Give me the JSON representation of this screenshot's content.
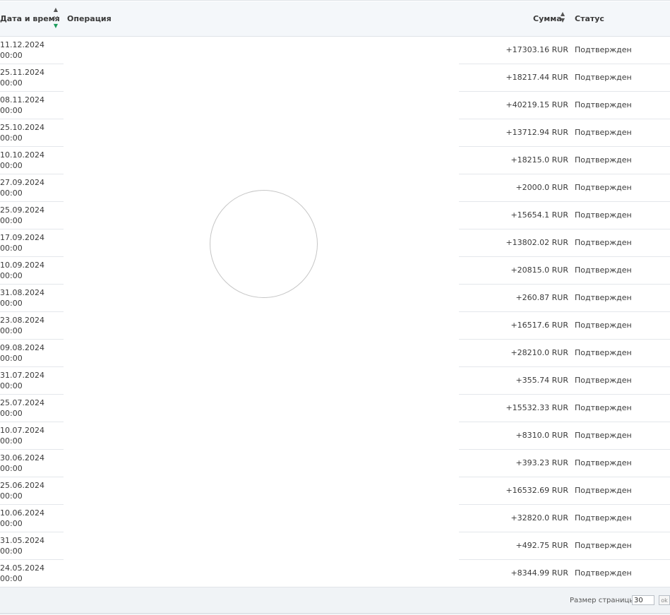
{
  "table": {
    "columns": {
      "date": "Дата и время",
      "operation": "Операция",
      "sum": "Сумма",
      "status": "Статус"
    },
    "sort": {
      "date_clear": "×",
      "up": "▲",
      "down": "▼"
    },
    "rows": [
      {
        "date": "11.12.2024",
        "time": "00:00",
        "sum": "+17303.16 RUR",
        "status": "Подтвержден"
      },
      {
        "date": "25.11.2024",
        "time": "00:00",
        "sum": "+18217.44 RUR",
        "status": "Подтвержден"
      },
      {
        "date": "08.11.2024",
        "time": "00:00",
        "sum": "+40219.15 RUR",
        "status": "Подтвержден"
      },
      {
        "date": "25.10.2024",
        "time": "00:00",
        "sum": "+13712.94 RUR",
        "status": "Подтвержден"
      },
      {
        "date": "10.10.2024",
        "time": "00:00",
        "sum": "+18215.0 RUR",
        "status": "Подтвержден"
      },
      {
        "date": "27.09.2024",
        "time": "00:00",
        "sum": "+2000.0 RUR",
        "status": "Подтвержден"
      },
      {
        "date": "25.09.2024",
        "time": "00:00",
        "sum": "+15654.1 RUR",
        "status": "Подтвержден"
      },
      {
        "date": "17.09.2024",
        "time": "00:00",
        "sum": "+13802.02 RUR",
        "status": "Подтвержден"
      },
      {
        "date": "10.09.2024",
        "time": "00:00",
        "sum": "+20815.0 RUR",
        "status": "Подтвержден"
      },
      {
        "date": "31.08.2024",
        "time": "00:00",
        "sum": "+260.87 RUR",
        "status": "Подтвержден"
      },
      {
        "date": "23.08.2024",
        "time": "00:00",
        "sum": "+16517.6 RUR",
        "status": "Подтвержден"
      },
      {
        "date": "09.08.2024",
        "time": "00:00",
        "sum": "+28210.0 RUR",
        "status": "Подтвержден"
      },
      {
        "date": "31.07.2024",
        "time": "00:00",
        "sum": "+355.74 RUR",
        "status": "Подтвержден"
      },
      {
        "date": "25.07.2024",
        "time": "00:00",
        "sum": "+15532.33 RUR",
        "status": "Подтвержден"
      },
      {
        "date": "10.07.2024",
        "time": "00:00",
        "sum": "+8310.0 RUR",
        "status": "Подтвержден"
      },
      {
        "date": "30.06.2024",
        "time": "00:00",
        "sum": "+393.23 RUR",
        "status": "Подтвержден"
      },
      {
        "date": "25.06.2024",
        "time": "00:00",
        "sum": "+16532.69 RUR",
        "status": "Подтвержден"
      },
      {
        "date": "10.06.2024",
        "time": "00:00",
        "sum": "+32820.0 RUR",
        "status": "Подтвержден"
      },
      {
        "date": "31.05.2024",
        "time": "00:00",
        "sum": "+492.75 RUR",
        "status": "Подтвержден"
      },
      {
        "date": "24.05.2024",
        "time": "00:00",
        "sum": "+8344.99 RUR",
        "status": "Подтвержден"
      }
    ]
  },
  "footer": {
    "page_size_label": "Размер страницы",
    "page_size_value": "30",
    "ok_label": "ok"
  },
  "icons": {
    "loading": "loading-spinner-icon"
  }
}
